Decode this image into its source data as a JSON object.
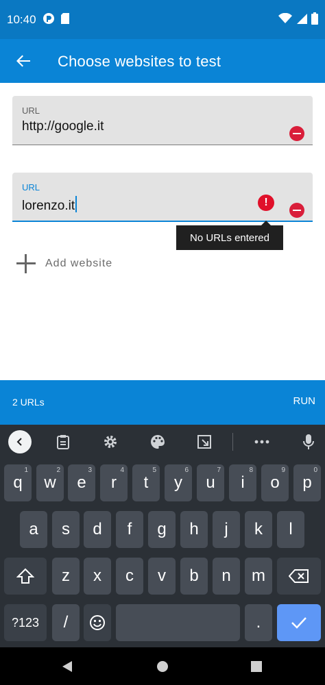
{
  "status": {
    "time": "10:40"
  },
  "appbar": {
    "title": "Choose websites to test"
  },
  "fields": [
    {
      "label": "URL",
      "value": "http://google.it"
    },
    {
      "label": "URL",
      "value": "lorenzo.it"
    }
  ],
  "error": {
    "icon_text": "!",
    "tooltip": "No URLs entered"
  },
  "add_website": {
    "label": "Add website"
  },
  "bottombar": {
    "count": "2 URLs",
    "run": "RUN"
  },
  "keyboard": {
    "row1": [
      {
        "k": "q",
        "h": "1"
      },
      {
        "k": "w",
        "h": "2"
      },
      {
        "k": "e",
        "h": "3"
      },
      {
        "k": "r",
        "h": "4"
      },
      {
        "k": "t",
        "h": "5"
      },
      {
        "k": "y",
        "h": "6"
      },
      {
        "k": "u",
        "h": "7"
      },
      {
        "k": "i",
        "h": "8"
      },
      {
        "k": "o",
        "h": "9"
      },
      {
        "k": "p",
        "h": "0"
      }
    ],
    "row2": [
      "a",
      "s",
      "d",
      "f",
      "g",
      "h",
      "j",
      "k",
      "l"
    ],
    "row3": [
      "z",
      "x",
      "c",
      "v",
      "b",
      "n",
      "m"
    ],
    "sym_label": "?123",
    "slash": "/",
    "period": "."
  },
  "colors": {
    "primary": "#0a84d6",
    "error": "#e0102a"
  }
}
